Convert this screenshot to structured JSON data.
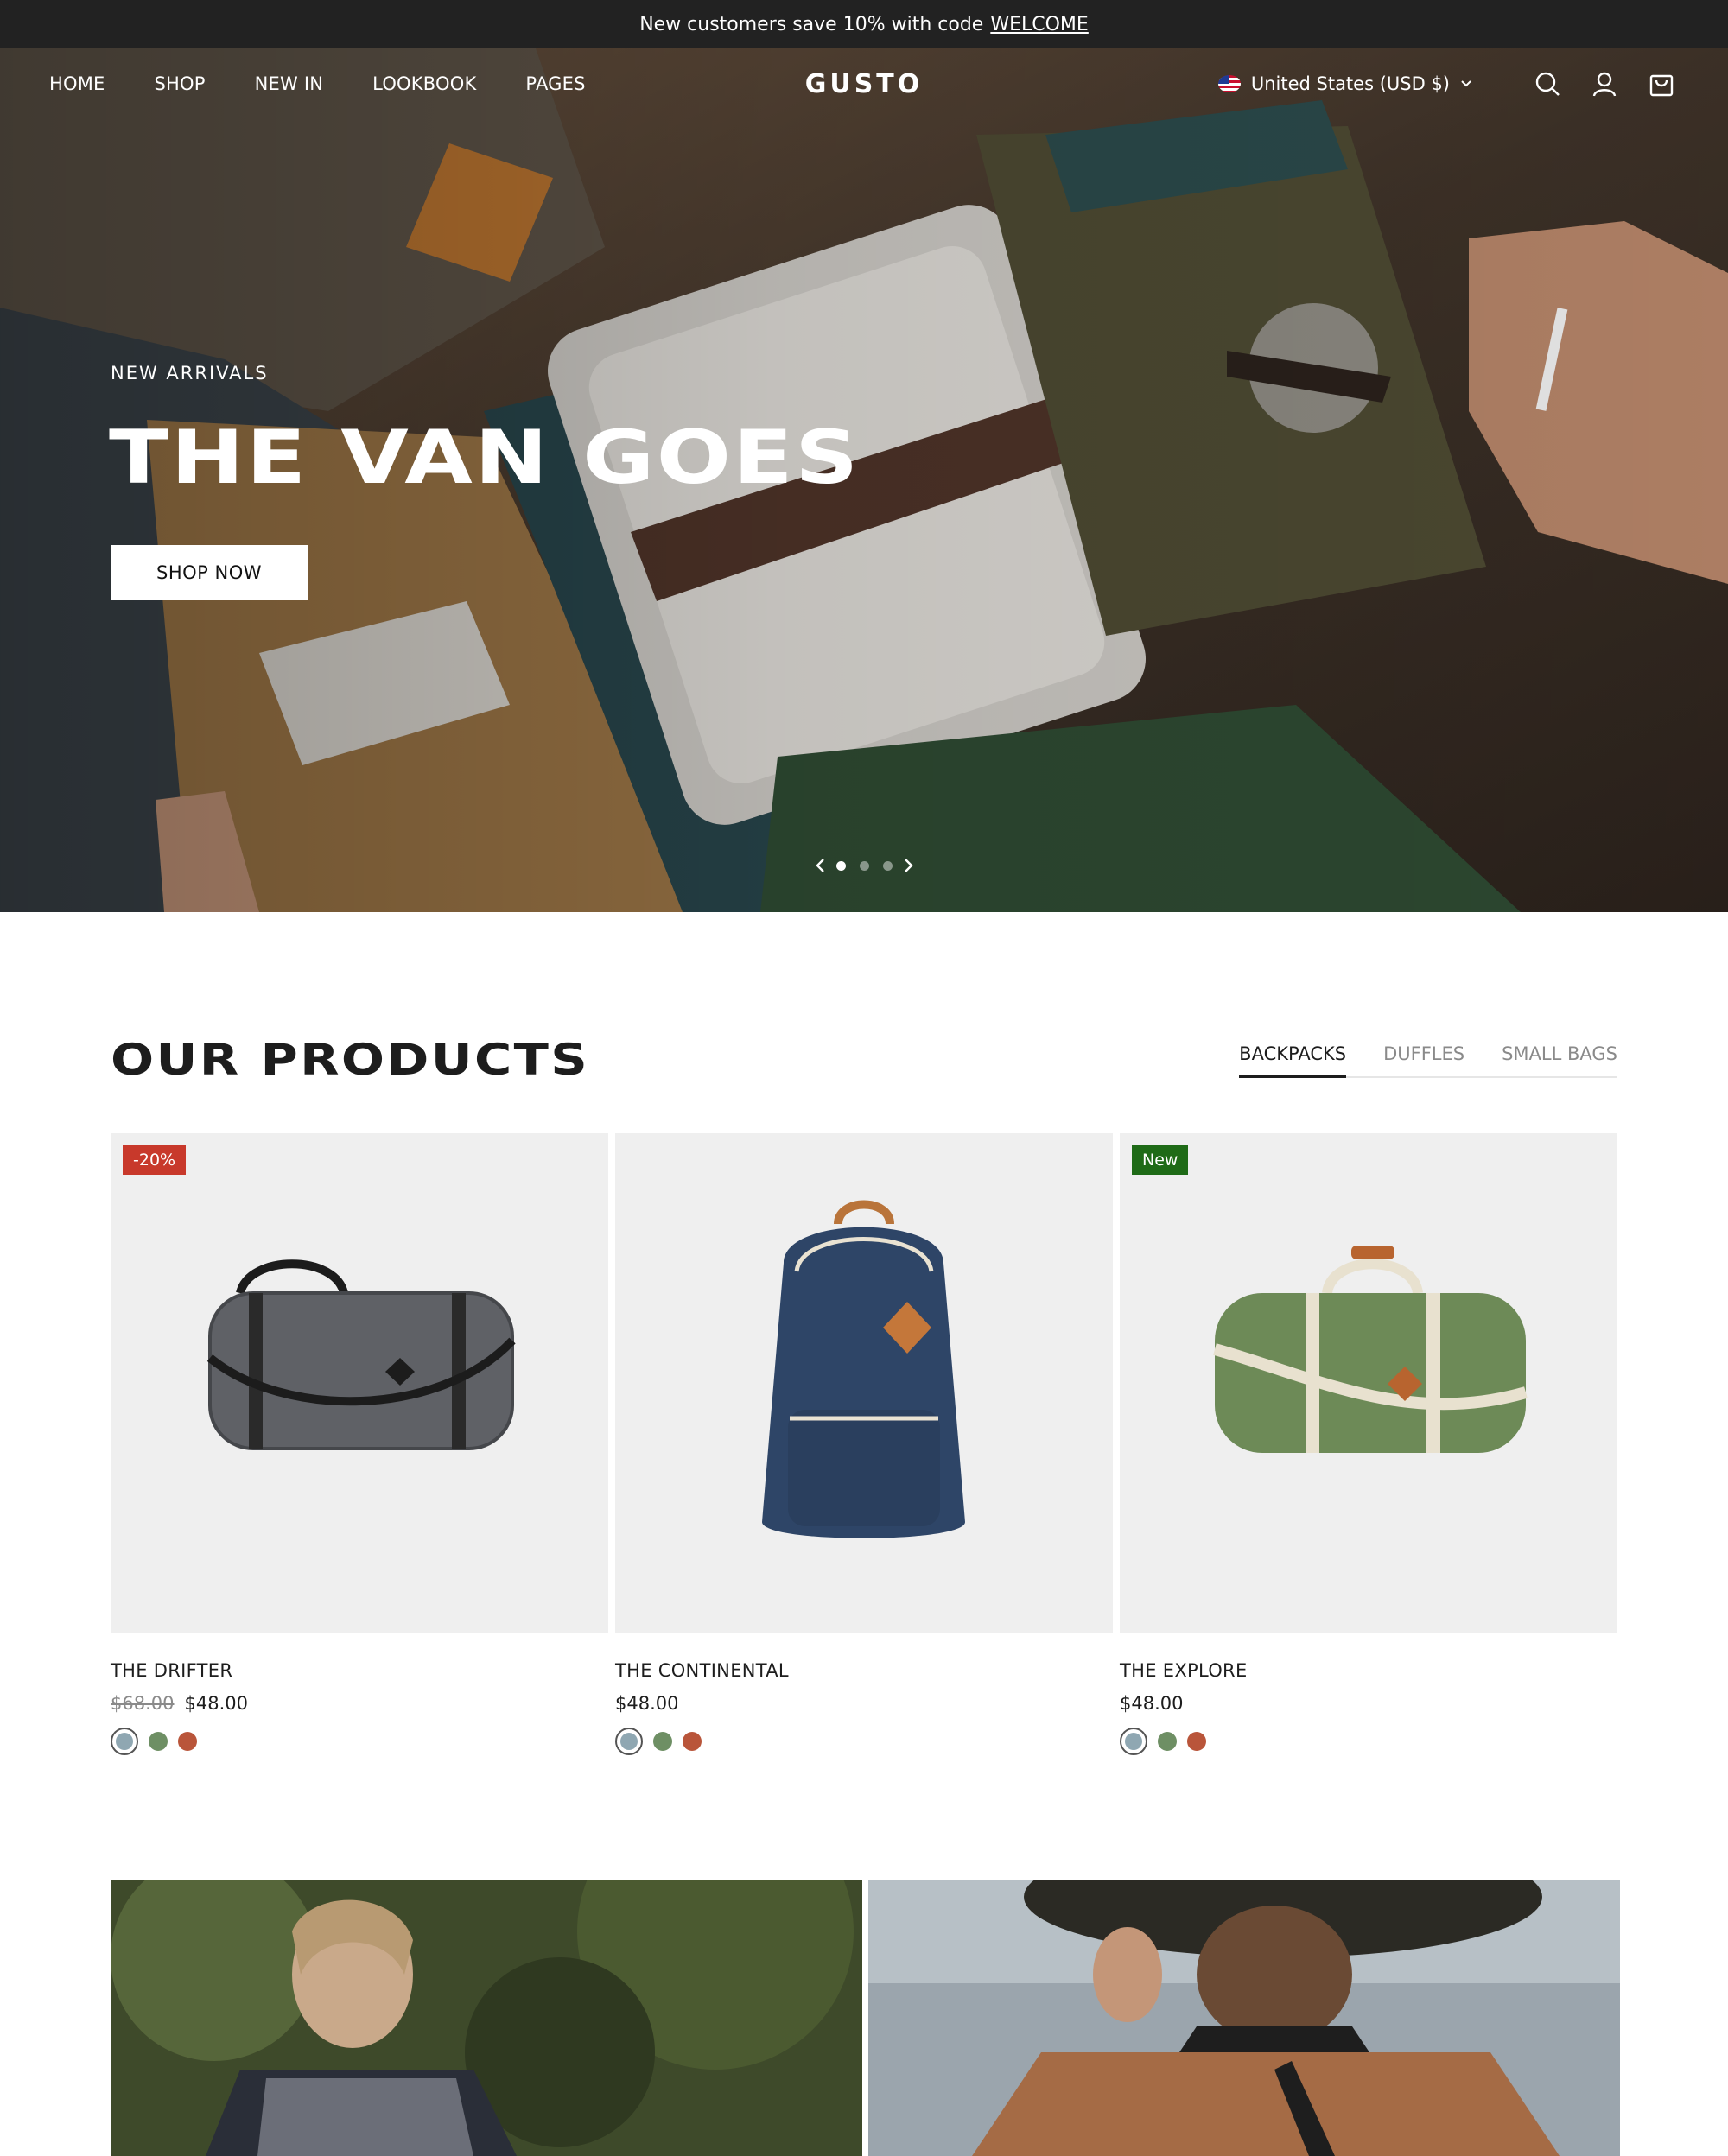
{
  "announcement": {
    "text": "New customers save 10% with code",
    "code": "WELCOME"
  },
  "header": {
    "logo": "GUSTO",
    "nav": [
      "HOME",
      "SHOP",
      "NEW IN",
      "LOOKBOOK",
      "PAGES"
    ],
    "locale": "United States (USD $)",
    "icons": [
      "search-icon",
      "account-icon",
      "cart-icon"
    ]
  },
  "hero": {
    "eyebrow": "NEW ARRIVALS",
    "title": "THE VAN GOES",
    "cta": "SHOP NOW",
    "slides_total": 3,
    "active_slide": 1
  },
  "products": {
    "title": "OUR PRODUCTS",
    "tabs": [
      "BACKPACKS",
      "DUFFLES",
      "SMALL BAGS"
    ],
    "active_tab": "BACKPACKS",
    "items": [
      {
        "name": "THE DRIFTER",
        "badge": "-20%",
        "price_old": "$68.00",
        "price": "$48.00",
        "swatches": [
          "#8fa7b2",
          "#6e8f64",
          "#b9553a"
        ]
      },
      {
        "name": "THE CONTINENTAL",
        "badge": "",
        "price_old": "",
        "price": "$48.00",
        "swatches": [
          "#8fa7b2",
          "#6e8f64",
          "#b9553a"
        ]
      },
      {
        "name": "THE EXPLORE",
        "badge": "New",
        "price_old": "",
        "price": "$48.00",
        "swatches": [
          "#8fa7b2",
          "#6e8f64",
          "#b9553a"
        ]
      }
    ]
  },
  "colors": {
    "announcement_bg": "#222222",
    "sale_badge": "#c8392b",
    "new_badge": "#1f6b17"
  }
}
